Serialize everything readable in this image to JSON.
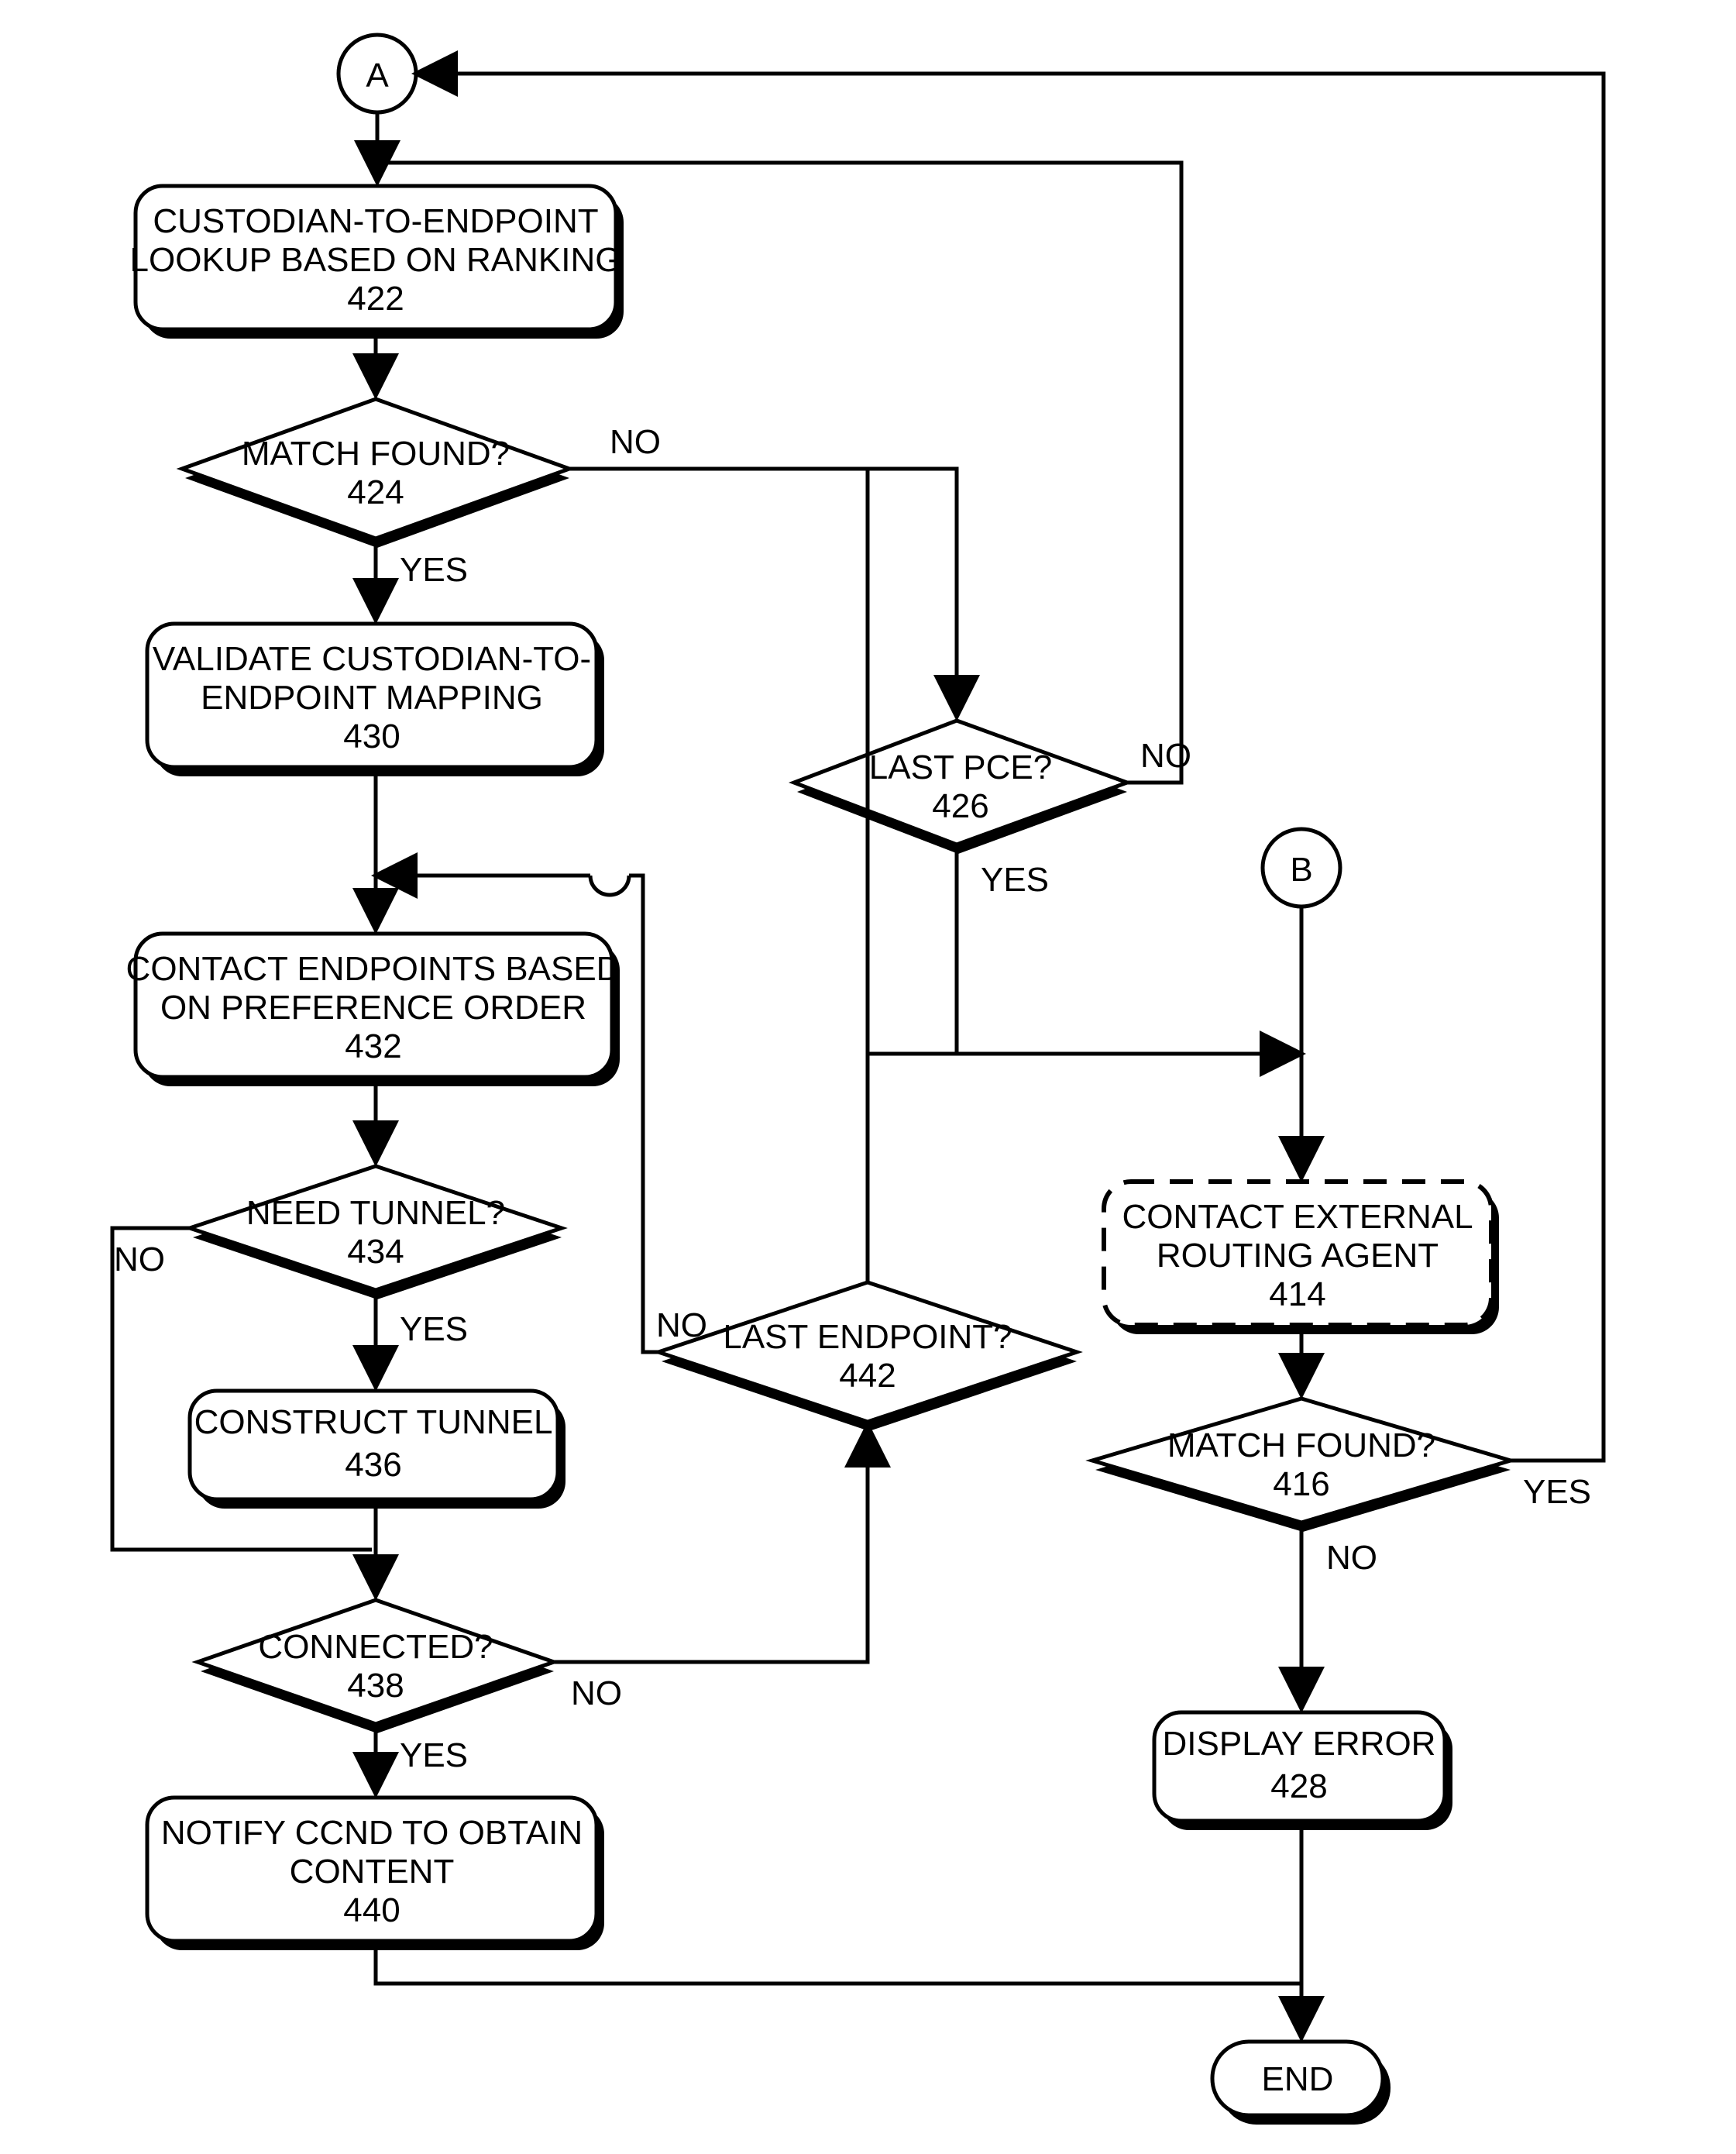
{
  "connectors": {
    "A": "A",
    "B": "B"
  },
  "labels": {
    "yes": "YES",
    "no": "NO"
  },
  "terminator": {
    "end": "END"
  },
  "blocks": {
    "422": {
      "line1": "CUSTODIAN-TO-ENDPOINT",
      "line2": "LOOKUP BASED ON RANKING",
      "ref": "422"
    },
    "424": {
      "line1": "MATCH FOUND?",
      "ref": "424"
    },
    "430": {
      "line1": "VALIDATE CUSTODIAN-TO-",
      "line2": "ENDPOINT MAPPING",
      "ref": "430"
    },
    "426": {
      "line1": "LAST PCE?",
      "ref": "426"
    },
    "432": {
      "line1": "CONTACT ENDPOINTS BASED",
      "line2": "ON PREFERENCE ORDER",
      "ref": "432"
    },
    "434": {
      "line1": "NEED TUNNEL?",
      "ref": "434"
    },
    "436": {
      "line1": "CONSTRUCT TUNNEL",
      "ref": "436"
    },
    "442": {
      "line1": "LAST ENDPOINT?",
      "ref": "442"
    },
    "414": {
      "line1": "CONTACT EXTERNAL",
      "line2": "ROUTING AGENT",
      "ref": "414"
    },
    "416": {
      "line1": "MATCH FOUND?",
      "ref": "416"
    },
    "438": {
      "line1": "CONNECTED?",
      "ref": "438"
    },
    "440": {
      "line1": "NOTIFY CCND TO OBTAIN",
      "line2": "CONTENT",
      "ref": "440"
    },
    "428": {
      "line1": "DISPLAY ERROR",
      "ref": "428"
    }
  }
}
